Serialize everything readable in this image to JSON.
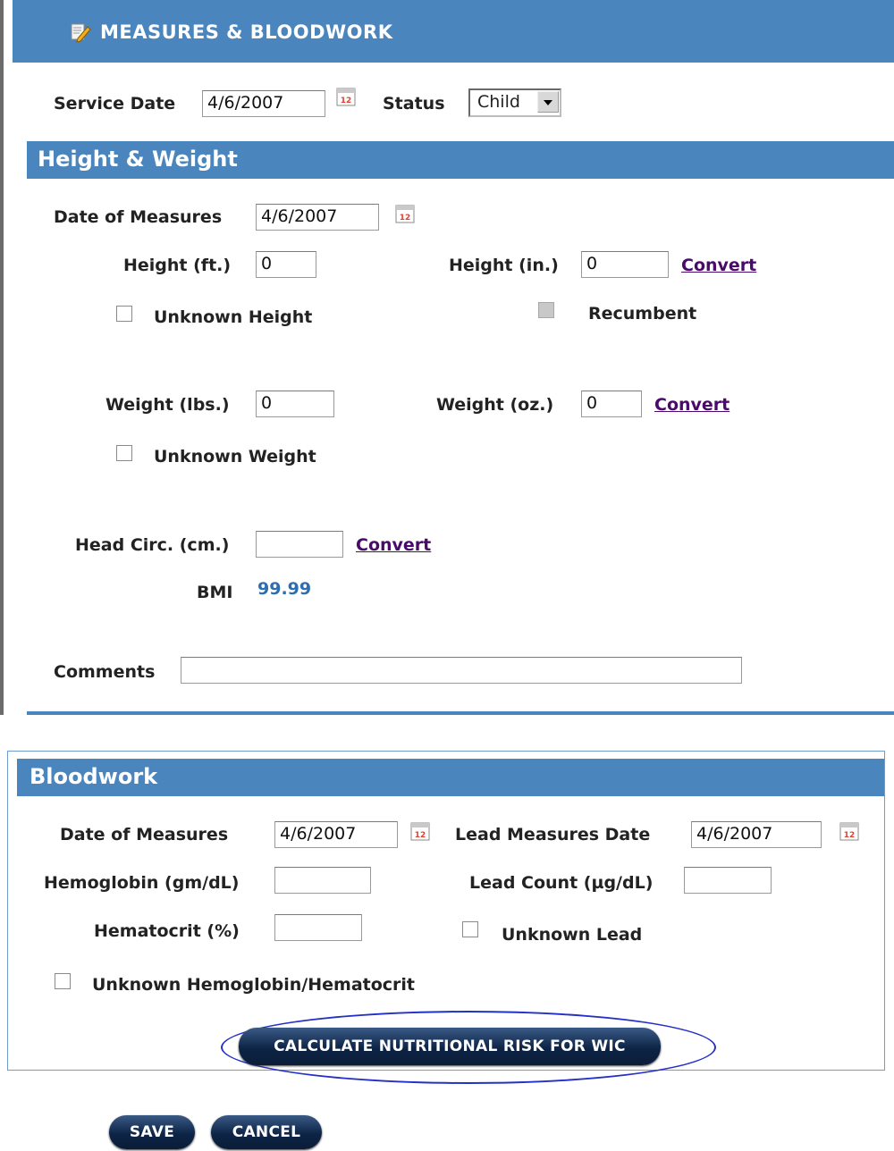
{
  "header": {
    "title": "MEASURES & BLOODWORK",
    "icon": "edit-note-icon"
  },
  "service": {
    "service_date_label": "Service Date",
    "service_date_value": "4/6/2007",
    "status_label": "Status",
    "status_value": "Child"
  },
  "height_weight": {
    "section_title": "Height & Weight",
    "date_label": "Date of Measures",
    "date_value": "4/6/2007",
    "height_ft_label": "Height (ft.)",
    "height_ft_value": "0",
    "height_in_label": "Height (in.)",
    "height_in_value": "0",
    "convert_label": "Convert",
    "unknown_height_label": "Unknown Height",
    "recumbent_label": "Recumbent",
    "weight_lbs_label": "Weight (lbs.)",
    "weight_lbs_value": "0",
    "weight_oz_label": "Weight (oz.)",
    "weight_oz_value": "0",
    "unknown_weight_label": "Unknown Weight",
    "head_circ_label": "Head Circ. (cm.)",
    "head_circ_value": "",
    "bmi_label": "BMI",
    "bmi_value": "99.99",
    "comments_label": "Comments",
    "comments_value": ""
  },
  "bloodwork": {
    "section_title": "Bloodwork",
    "date_label": "Date of Measures",
    "date_value": "4/6/2007",
    "lead_date_label": "Lead Measures Date",
    "lead_date_value": "4/6/2007",
    "hemoglobin_label": "Hemoglobin (gm/dL)",
    "hemoglobin_value": "",
    "lead_count_label": "Lead Count (µg/dL)",
    "lead_count_value": "",
    "hematocrit_label": "Hematocrit (%)",
    "hematocrit_value": "",
    "unknown_lead_label": "Unknown Lead",
    "unknown_hgb_label": "Unknown Hemoglobin/Hematocrit",
    "calculate_label": "CALCULATE NUTRITIONAL RISK FOR WIC"
  },
  "actions": {
    "save_label": "SAVE",
    "cancel_label": "CANCEL"
  },
  "colors": {
    "header_blue": "#4a86bd",
    "link_purple": "#4a0a6b",
    "bmi_blue": "#2e6db0",
    "button_navy": "#0d2446"
  }
}
